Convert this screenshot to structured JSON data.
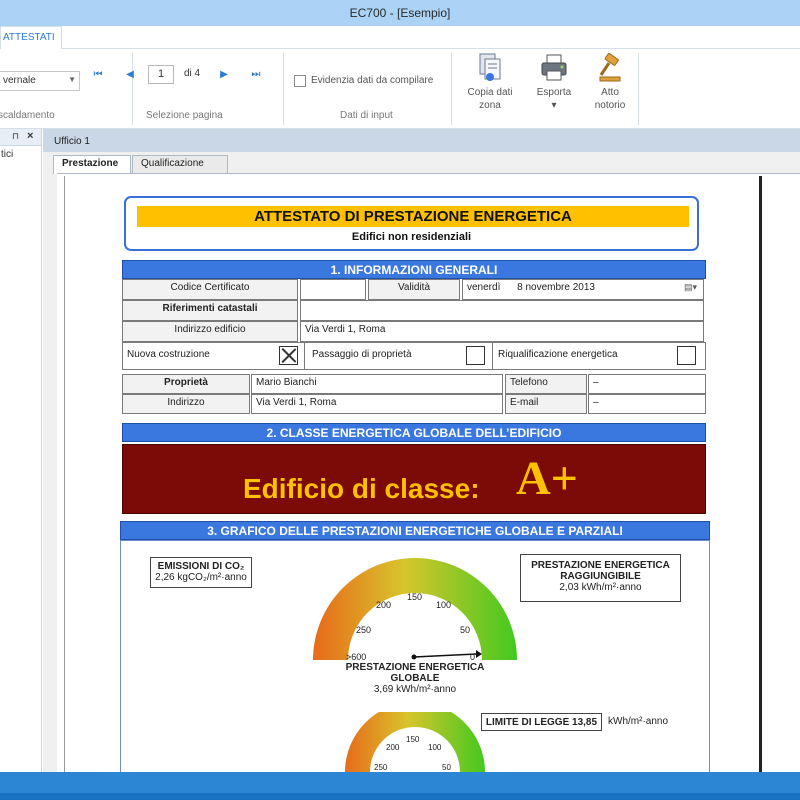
{
  "window": {
    "title": "EC700 - [Esempio]"
  },
  "ribbon": {
    "tab_active": "ATTESTATI",
    "groups": {
      "riscaldamento": {
        "label": "scaldamento",
        "combo_value": "vernale"
      },
      "selezione_pagina": {
        "label": "Selezione pagina",
        "current_page": "1",
        "of_text": "di 4"
      },
      "dati_input": {
        "label": "Dati di input",
        "checkbox_label": "Evidenzia dati da compilare"
      }
    },
    "buttons": {
      "copia": {
        "line1": "Copia dati",
        "line2": "zona"
      },
      "esporta": {
        "line1": "Esporta",
        "line2": "▾"
      },
      "atto": {
        "line1": "Atto",
        "line2": "notorio"
      }
    }
  },
  "left_panel": {
    "pin": "⊓",
    "close": "×",
    "item": "tici"
  },
  "document": {
    "tab": "Ufficio 1",
    "inner_tabs": [
      "Prestazione",
      "Qualificazione"
    ],
    "active_inner_tab": 0
  },
  "certificate": {
    "title": "ATTESTATO DI PRESTAZIONE ENERGETICA",
    "subtitle": "Edifici non residenziali",
    "section1": {
      "header": "1. INFORMAZIONI GENERALI",
      "codice_label": "Codice Certificato",
      "codice_value": "",
      "validita_label": "Validità",
      "validita_day": "venerdì",
      "validita_date": "8 novembre 2013",
      "riferimenti_label": "Riferimenti catastali",
      "riferimenti_value": "",
      "indirizzo_edificio_label": "Indirizzo edificio",
      "indirizzo_edificio_value": "Via Verdi 1, Roma",
      "nuova_costruzione": {
        "label": "Nuova costruzione",
        "checked": true
      },
      "passaggio": {
        "label": "Passaggio di proprietà",
        "checked": false
      },
      "riqualificazione": {
        "label": "Riqualificazione energetica",
        "checked": false
      },
      "proprieta_label": "Proprietà",
      "proprieta_value": "Mario Bianchi",
      "telefono_label": "Telefono",
      "telefono_value": "–",
      "indirizzo_label": "Indirizzo",
      "indirizzo_value": "Via Verdi 1, Roma",
      "email_label": "E-mail",
      "email_value": "–"
    },
    "section2": {
      "header": "2. CLASSE ENERGETICA GLOBALE DELL’EDIFICIO",
      "class_text": "Edificio di classe:",
      "class_letter": "A+"
    },
    "section3": {
      "header": "3. GRAFICO DELLE PRESTAZIONI ENERGETICHE GLOBALE E PARZIALI",
      "emissioni": {
        "title": "EMISSIONI DI CO₂",
        "value": "2,26 kgCO₂/m²·anno"
      },
      "raggiungibile": {
        "title_line1": "PRESTAZIONE ENERGETICA",
        "title_line2": "RAGGIUNGIBILE",
        "value": "2,03 kWh/m²·anno"
      },
      "globale": {
        "title_line1": "PRESTAZIONE ENERGETICA",
        "title_line2": "GLOBALE",
        "value": "3,69 kWh/m²·anno"
      },
      "limite": {
        "label": "LIMITE DI LEGGE 13,85",
        "unit": "kWh/m²·anno"
      },
      "gauge1_ticks": [
        ">600",
        "250",
        "200",
        "150",
        "100",
        "50",
        "0"
      ],
      "gauge2_ticks": [
        "250",
        "200",
        "150",
        "100",
        "50"
      ]
    }
  },
  "colors": {
    "accent": "#3a78e0",
    "title_yellow": "#ffc000",
    "class_bg": "#7c0a07",
    "statusbar": "#2c86d3"
  }
}
